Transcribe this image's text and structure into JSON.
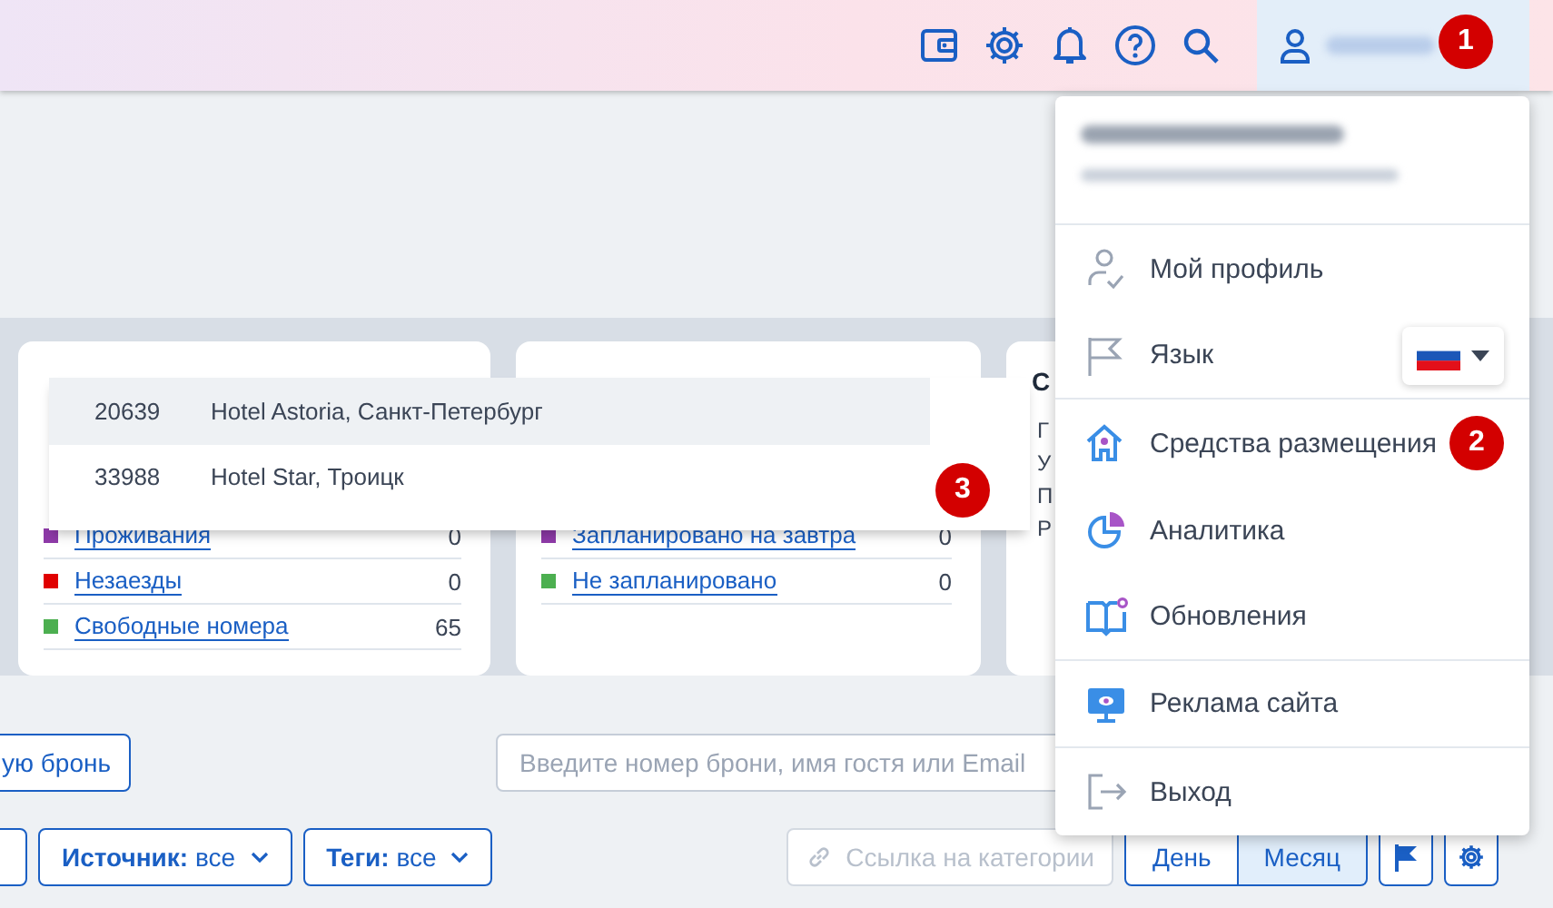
{
  "header": {
    "user_button": {
      "callout": "1"
    }
  },
  "stats_cards": [
    {
      "rows": [
        {
          "label": "Проживания",
          "count": "0",
          "color": "#8e3aa8"
        },
        {
          "label": "Незаезды",
          "count": "0",
          "color": "#e00000"
        },
        {
          "label": "Свободные номера",
          "count": "65",
          "color": "#4caf50"
        }
      ]
    },
    {
      "rows": [
        {
          "label": "Запланировано на завтра",
          "count": "0",
          "color": "#8e3aa8"
        },
        {
          "label": "Не запланировано",
          "count": "0",
          "color": "#4caf50"
        }
      ]
    }
  ],
  "side_card": {
    "title": "С",
    "lines": [
      "Г",
      "У",
      "П",
      "Р"
    ]
  },
  "hotel_dropdown": {
    "options": [
      {
        "id": "20639",
        "name": "Hotel Astoria, Санкт-Петербург",
        "selected": true
      },
      {
        "id": "33988",
        "name": "Hotel Star, Троицк",
        "selected": false
      }
    ],
    "callout": "3"
  },
  "toolbar": {
    "new_booking_button": "ую бронь",
    "search": {
      "placeholder": "Введите номер брони, имя гостя или Email"
    }
  },
  "filters": [
    {
      "label": "Источник:",
      "value": "все"
    },
    {
      "label": "Теги:",
      "value": "все"
    }
  ],
  "category_link_button": {
    "label": "Ссылка на категории",
    "disabled": true
  },
  "view_modes": [
    {
      "label": "День",
      "selected": false
    },
    {
      "label": "Месяц",
      "selected": true
    }
  ],
  "user_menu": {
    "items": [
      {
        "kind": "link",
        "label": "Мой профиль",
        "divider_after": false
      },
      {
        "kind": "language",
        "label": "Язык",
        "divider_after": true
      },
      {
        "kind": "link",
        "label": "Средства размещения",
        "divider_after": false,
        "callout": "2"
      },
      {
        "kind": "link",
        "label": "Аналитика",
        "divider_after": false
      },
      {
        "kind": "link",
        "label": "Обновления",
        "divider_after": true
      },
      {
        "kind": "link",
        "label": "Реклама сайта",
        "divider_after": true
      },
      {
        "kind": "link",
        "label": "Выход",
        "divider_after": false
      }
    ]
  }
}
